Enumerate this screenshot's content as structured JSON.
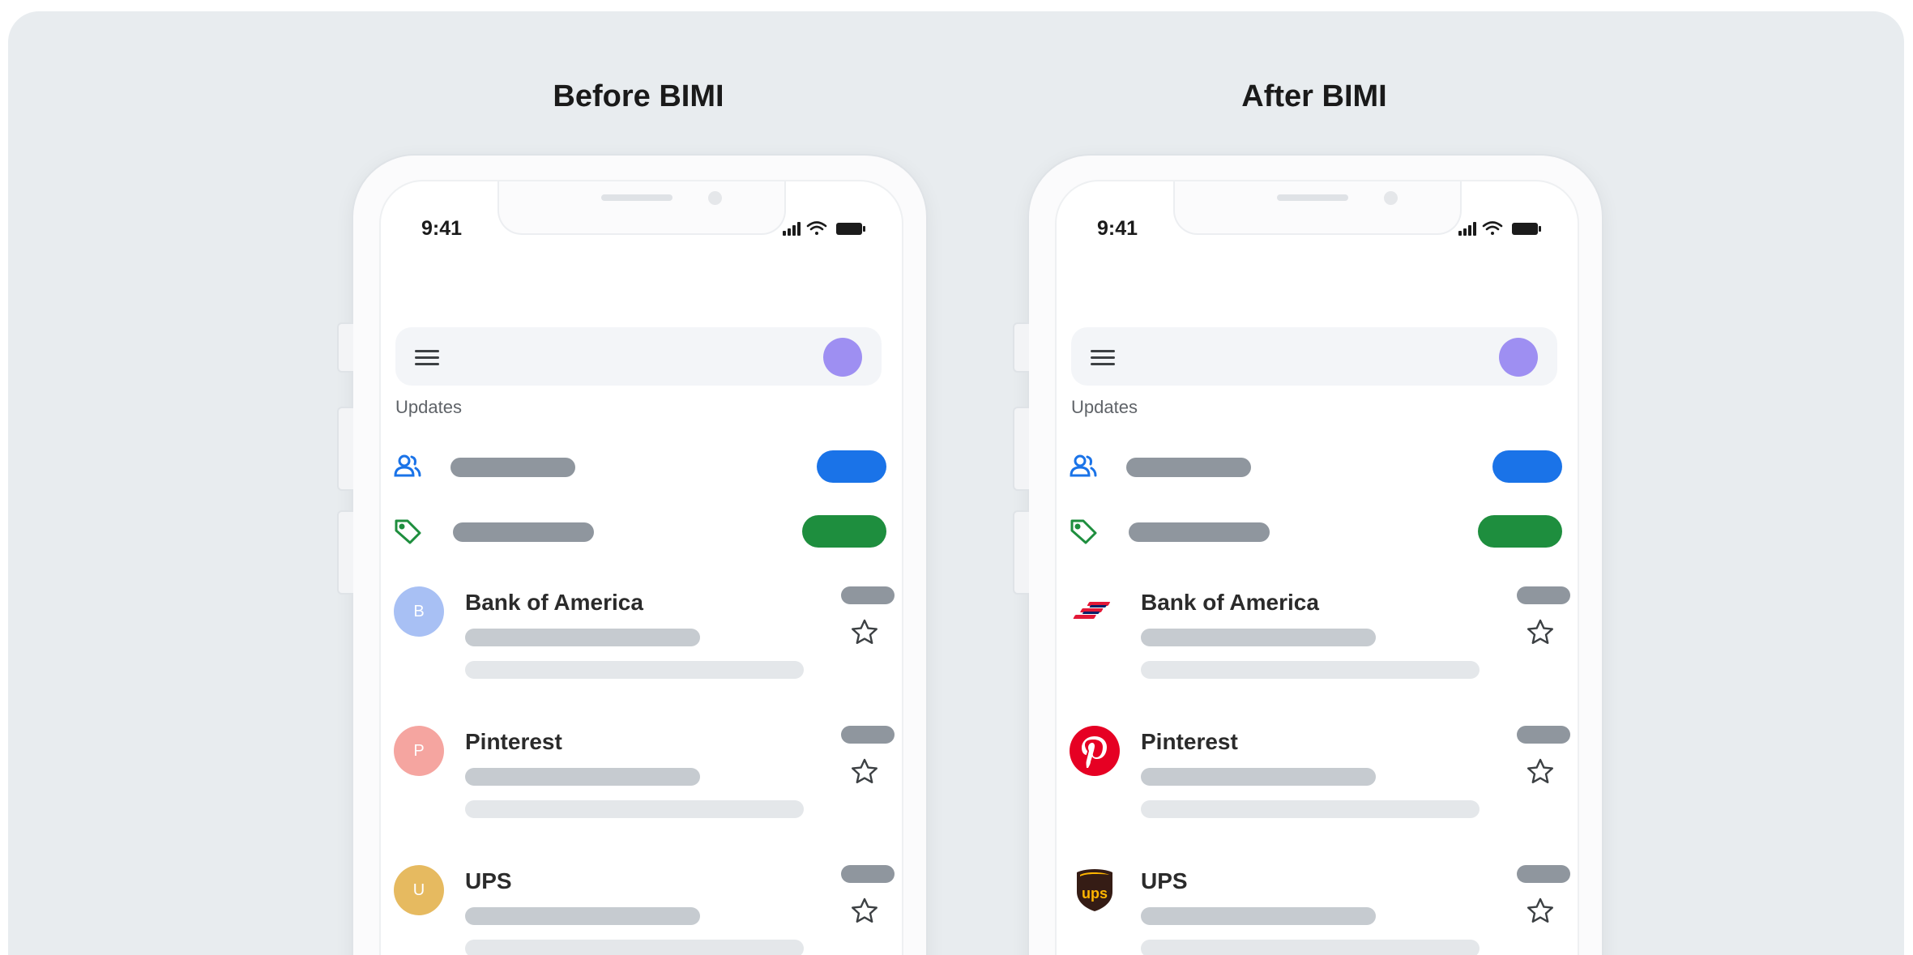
{
  "panels": [
    {
      "title": "Before BIMI",
      "status": {
        "time": "9:41"
      },
      "section_label": "Updates",
      "messages": [
        {
          "sender": "Bank of America",
          "avatar_letter": "B",
          "avatar_color": "#a8c0f4"
        },
        {
          "sender": "Pinterest",
          "avatar_letter": "P",
          "avatar_color": "#f5a5a0"
        },
        {
          "sender": "UPS",
          "avatar_letter": "U",
          "avatar_color": "#e6ba60"
        }
      ]
    },
    {
      "title": "After BIMI",
      "status": {
        "time": "9:41"
      },
      "section_label": "Updates",
      "messages": [
        {
          "sender": "Bank of America",
          "logo": "bank-of-america-logo"
        },
        {
          "sender": "Pinterest",
          "logo": "pinterest-logo"
        },
        {
          "sender": "UPS",
          "logo": "ups-logo"
        }
      ]
    }
  ],
  "colors": {
    "social_pill": "#1a73e8",
    "promotions_pill": "#1e8e3e",
    "account_avatar": "#9e8ff2",
    "placeholder_dark": "#8f969e",
    "placeholder_mid": "#c6cbd0",
    "placeholder_light": "#e4e7ea"
  },
  "icons": {
    "menu": "hamburger-menu-icon",
    "social": "people-icon",
    "promotions": "tag-icon",
    "star": "star-outline-icon",
    "signal": "cellular-signal-icon",
    "wifi": "wifi-icon",
    "battery": "battery-icon"
  }
}
